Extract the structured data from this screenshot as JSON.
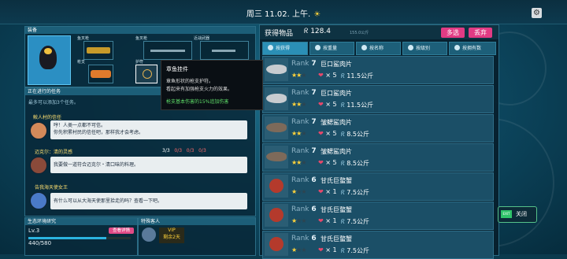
{
  "header": {
    "date": "周三 11.02. 上午.",
    "sun_icon": "☀",
    "settings_icon": "gear-icon"
  },
  "equipment": {
    "title": "装备",
    "slots": {
      "harpoon": "鱼叉枪",
      "harpoon2": "鱼叉枪",
      "melee": "近战武器",
      "gun": "枪支",
      "charm": "护符"
    }
  },
  "tooltip": {
    "title": "章鱼挂件",
    "line1": "章鱼形状的枪支护符。",
    "line2": "看起来有加强枪支火力的效果。",
    "effect": "枪支基本伤害的15%追加伤害"
  },
  "tasks": {
    "title": "正在进行的任务",
    "subtitle": "最多可以添加3个任务。",
    "items": [
      {
        "name": "鲛人村的信任",
        "text1": "哼！人类一点都不可信。",
        "text2": "你先积累村民的信任吧，那样我才会考虑。"
      },
      {
        "name": "迈克尔：清的灵感",
        "counts": [
          "3/3",
          "0/3",
          "0/3",
          "0/3"
        ],
        "text": "我要做一道符合迈克尔・清口味的料理。"
      },
      {
        "name": "告我海天使女王",
        "text": "有什么可以从大海天使那里拾走的吗？查看一下吧。"
      }
    ]
  },
  "eco": {
    "title": "生态环境研究",
    "level": "Lv.3",
    "progress": "440/580",
    "progress_fraction": 0.76,
    "detail_button": "查看详情"
  },
  "guest": {
    "title": "特殊客人",
    "vip": "VIP",
    "remain": "剩余2天"
  },
  "items_panel": {
    "title": "获得物品",
    "currency": "128.4",
    "capacity": "155.0公斤",
    "select_all": "多选",
    "discard": "丢弃",
    "tabs": [
      "按获得",
      "按重量",
      "按名称",
      "按级别",
      "按拥有数"
    ],
    "rows": [
      {
        "rank_label": "Rank",
        "rank": "7",
        "name": "巨口鲨肉片",
        "stars": 2,
        "qty": "5",
        "weight": "11.5公斤",
        "kind": "shark"
      },
      {
        "rank_label": "Rank",
        "rank": "7",
        "name": "巨口鲨肉片",
        "stars": 2,
        "qty": "5",
        "weight": "11.5公斤",
        "kind": "shark"
      },
      {
        "rank_label": "Rank",
        "rank": "7",
        "name": "皱鳃鲨肉片",
        "stars": 2,
        "qty": "5",
        "weight": "8.5公斤",
        "kind": "dark"
      },
      {
        "rank_label": "Rank",
        "rank": "7",
        "name": "皱鳃鲨肉片",
        "stars": 2,
        "qty": "5",
        "weight": "8.5公斤",
        "kind": "dark"
      },
      {
        "rank_label": "Rank",
        "rank": "6",
        "name": "甘氏巨螯蟹",
        "stars": 1,
        "qty": "1",
        "weight": "7.5公斤",
        "kind": "crab"
      },
      {
        "rank_label": "Rank",
        "rank": "6",
        "name": "甘氏巨螯蟹",
        "stars": 1,
        "qty": "1",
        "weight": "7.5公斤",
        "kind": "crab"
      },
      {
        "rank_label": "Rank",
        "rank": "6",
        "name": "甘氏巨螯蟹",
        "stars": 1,
        "qty": "1",
        "weight": "7.5公斤",
        "kind": "crab"
      }
    ]
  },
  "exit": {
    "key": "EXIT",
    "label": "关闭"
  }
}
